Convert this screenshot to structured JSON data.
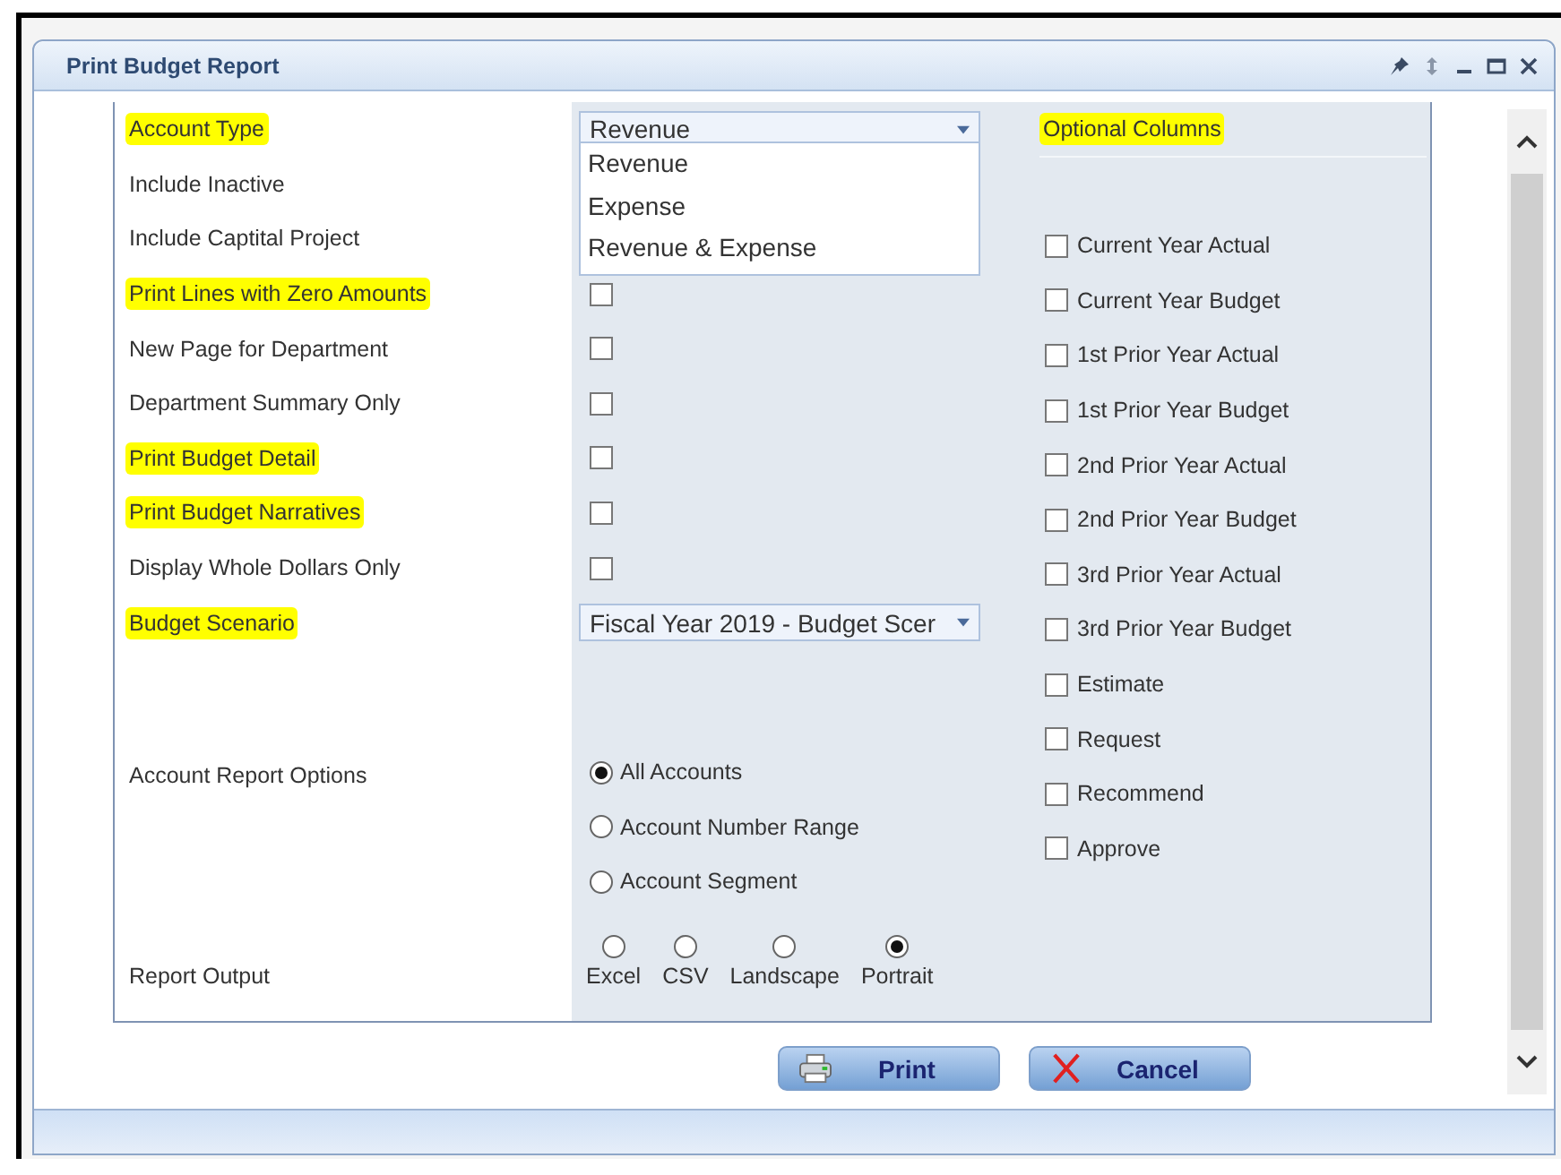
{
  "window": {
    "title": "Print Budget Report"
  },
  "fields": [
    {
      "label": "Account Type",
      "highlighted": true,
      "kind": "select",
      "value": "Revenue",
      "expanded": true,
      "options": [
        "Revenue",
        "Expense",
        "Revenue & Expense"
      ]
    },
    {
      "label": "Include Inactive",
      "highlighted": false,
      "kind": "covered"
    },
    {
      "label": "Include Captital Project",
      "highlighted": false,
      "kind": "covered"
    },
    {
      "label": "Print Lines with Zero Amounts",
      "highlighted": true,
      "kind": "checkbox",
      "checked": false
    },
    {
      "label": "New Page for Department",
      "highlighted": false,
      "kind": "checkbox",
      "checked": false
    },
    {
      "label": "Department Summary Only",
      "highlighted": false,
      "kind": "checkbox",
      "checked": false
    },
    {
      "label": "Print Budget Detail",
      "highlighted": true,
      "kind": "checkbox",
      "checked": false
    },
    {
      "label": "Print Budget Narratives",
      "highlighted": true,
      "kind": "checkbox",
      "checked": false
    },
    {
      "label": "Display Whole Dollars Only",
      "highlighted": false,
      "kind": "checkbox",
      "checked": false
    },
    {
      "label": "Budget Scenario",
      "highlighted": true,
      "kind": "select",
      "value": "Fiscal Year 2019 - Budget Scer",
      "expanded": false
    },
    {
      "label": "Account Report Options",
      "highlighted": false,
      "kind": "radio_list",
      "options": [
        {
          "label": "All Accounts",
          "selected": true
        },
        {
          "label": "Account Number Range",
          "selected": false
        },
        {
          "label": "Account Segment",
          "selected": false
        }
      ]
    },
    {
      "label": "Report Output",
      "highlighted": false,
      "kind": "radio_row",
      "options": [
        {
          "label": "Excel",
          "selected": false
        },
        {
          "label": "CSV",
          "selected": false
        },
        {
          "label": "Landscape",
          "selected": false
        },
        {
          "label": "Portrait",
          "selected": true
        }
      ]
    }
  ],
  "optional_columns": {
    "heading": "Optional Columns",
    "highlighted": true,
    "items": [
      {
        "label": "Current Year Actual",
        "checked": false
      },
      {
        "label": "Current Year Budget",
        "checked": false
      },
      {
        "label": "1st Prior Year Actual",
        "checked": false
      },
      {
        "label": "1st Prior Year Budget",
        "checked": false
      },
      {
        "label": "2nd Prior Year Actual",
        "checked": false
      },
      {
        "label": "2nd Prior Year Budget",
        "checked": false
      },
      {
        "label": "3rd Prior Year Actual",
        "checked": false
      },
      {
        "label": "3rd Prior Year Budget",
        "checked": false
      },
      {
        "label": "Estimate",
        "checked": false
      },
      {
        "label": "Request",
        "checked": false
      },
      {
        "label": "Recommend",
        "checked": false
      },
      {
        "label": "Approve",
        "checked": false
      }
    ]
  },
  "buttons": [
    {
      "label": "Print",
      "kind": "print"
    },
    {
      "label": "Cancel",
      "kind": "cancel"
    }
  ]
}
